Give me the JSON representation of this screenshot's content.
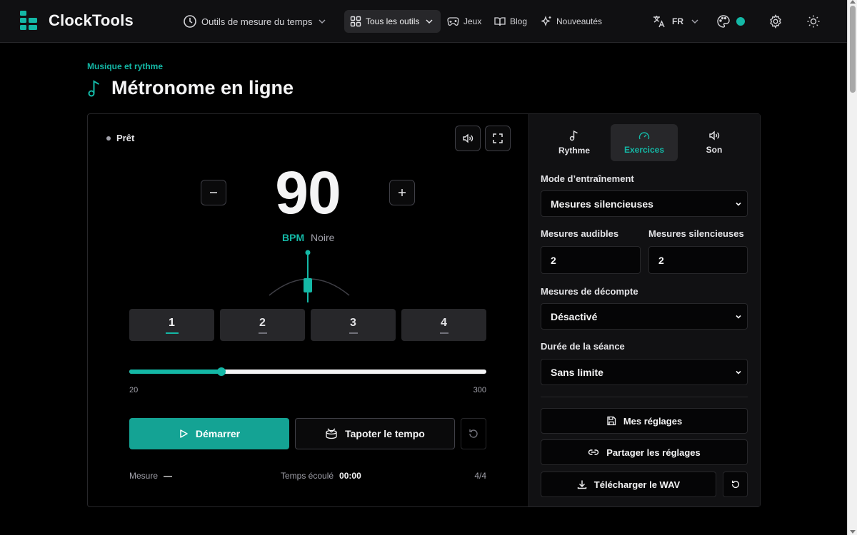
{
  "app": {
    "name": "ClockTools"
  },
  "nav": {
    "time_tools": "Outils de mesure du temps",
    "all_tools": "Tous les outils",
    "games": "Jeux",
    "blog": "Blog",
    "new": "Nouveautés",
    "language": "FR"
  },
  "colors": {
    "accent": "#14b8a6",
    "background": "#000000",
    "surface": "#111113",
    "border": "#27272a"
  },
  "page": {
    "breadcrumb": "Musique et rythme",
    "title": "Métronome en ligne"
  },
  "metronome": {
    "status": "Prêt",
    "bpm": "90",
    "bpm_unit": "BPM",
    "note_value": "Noire",
    "beats": [
      {
        "label": "1",
        "active": true
      },
      {
        "label": "2",
        "active": false
      },
      {
        "label": "3",
        "active": false
      },
      {
        "label": "4",
        "active": false
      }
    ],
    "range_min": "20",
    "range_max": "300",
    "tempo_fraction": 0.2571,
    "start_label": "Démarrer",
    "tap_label": "Tapoter le tempo",
    "measure_label": "Mesure",
    "measure_value": "—",
    "elapsed_label": "Temps écoulé",
    "elapsed_value": "00:00",
    "time_signature": "4/4"
  },
  "settings": {
    "tabs": [
      {
        "label": "Rythme",
        "icon": "music-note-icon",
        "active": false
      },
      {
        "label": "Exercices",
        "icon": "gauge-icon",
        "active": true
      },
      {
        "label": "Son",
        "icon": "speaker-icon",
        "active": false
      }
    ],
    "training_mode_label": "Mode d’entraînement",
    "training_mode_value": "Mesures silencieuses",
    "audible_measures_label": "Mesures audibles",
    "audible_measures_value": "2",
    "silent_measures_label": "Mesures silencieuses",
    "silent_measures_value": "2",
    "count_in_label": "Mesures de décompte",
    "count_in_value": "Désactivé",
    "session_duration_label": "Durée de la séance",
    "session_duration_value": "Sans limite",
    "my_settings": "Mes réglages",
    "share_settings": "Partager les réglages",
    "download_wav": "Télécharger le WAV"
  }
}
